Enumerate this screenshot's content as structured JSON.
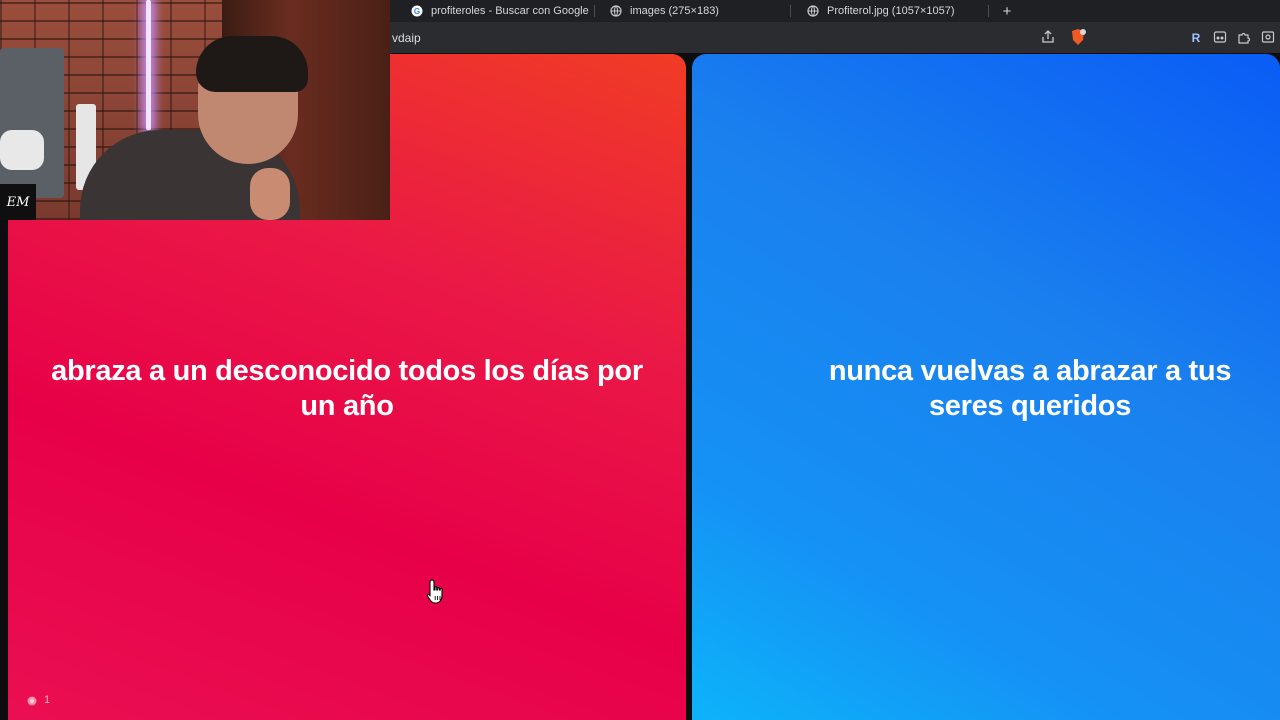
{
  "browser": {
    "tabs": [
      {
        "title": "profiteroles - Buscar con Google",
        "icon": "google-icon"
      },
      {
        "title": "images (275×183)",
        "icon": "globe-icon"
      },
      {
        "title": "Profiterol.jpg (1057×1057)",
        "icon": "globe-icon"
      }
    ],
    "new_tab_label": "+",
    "url_fragment": "vdaip",
    "toolbar_icons": [
      "share-icon",
      "brave-shield-icon",
      "extension-r-icon",
      "reader-icon",
      "puzzle-extensions-icon",
      "screenshot-icon"
    ]
  },
  "webcam": {
    "logo_text": "EM"
  },
  "options": {
    "left": {
      "text": "abraza a un desconocido todos los días por un año",
      "color": "#e8073f",
      "votes": "1"
    },
    "right": {
      "text": "nunca vuelvas a abrazar a tus seres queridos",
      "color": "#1488f2"
    }
  },
  "colors": {
    "tabbar": "#1f2023",
    "addressbar": "#2b2c30",
    "background": "#0d0d0f"
  }
}
